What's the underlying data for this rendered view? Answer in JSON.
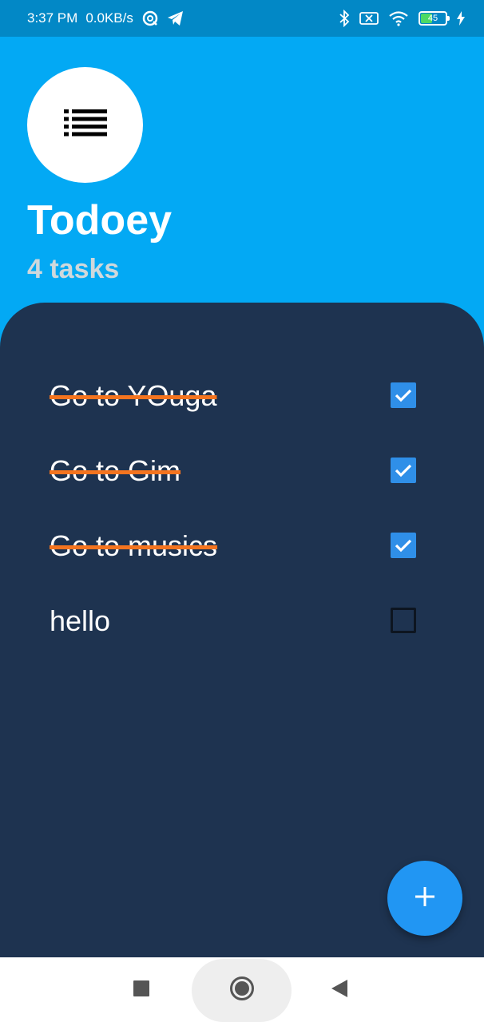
{
  "status_bar": {
    "time": "3:37 PM",
    "network_speed": "0.0KB/s",
    "battery_level": "45",
    "battery_fraction": 0.45,
    "icons": [
      "data-saver-icon",
      "telegram-icon",
      "bluetooth-icon",
      "no-sim-icon",
      "wifi-icon",
      "battery-icon",
      "charging-icon"
    ]
  },
  "header": {
    "logo_icon": "list-icon",
    "title": "Todoey",
    "task_count": "4 tasks"
  },
  "tasks": [
    {
      "label": "Go to YOuga",
      "done": true
    },
    {
      "label": "Go to Gim",
      "done": true
    },
    {
      "label": "Go to musics",
      "done": true
    },
    {
      "label": "hello",
      "done": false
    }
  ],
  "fab": {
    "icon": "plus-icon"
  },
  "nav": {
    "buttons": [
      "recents-square-icon",
      "home-circle-icon",
      "back-triangle-icon"
    ]
  },
  "colors": {
    "header_bg": "#03a9f4",
    "panel_bg": "#1e3350",
    "strike": "#f4741f",
    "check": "#2f8fe8",
    "fab": "#2196f3"
  }
}
